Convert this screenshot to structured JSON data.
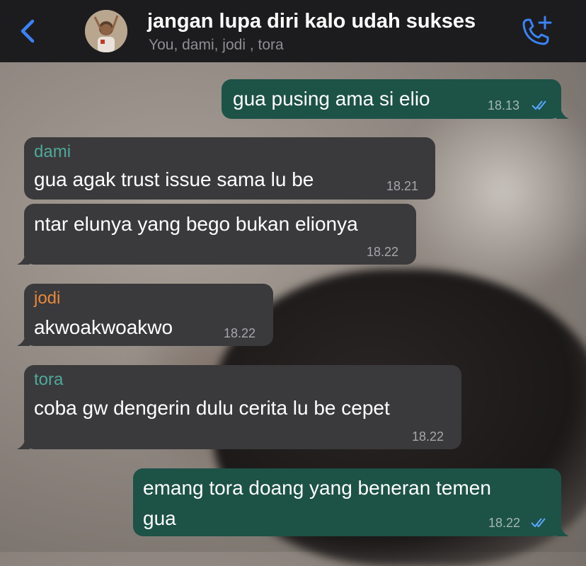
{
  "header": {
    "back_icon": "chevron-left-icon",
    "title": "jangan lupa diri kalo udah sukses",
    "subtitle": "You, dami, jodi , tora",
    "call_icon": "add-call-icon",
    "accent_color": "#3b82f6"
  },
  "messages": [
    {
      "direction": "outgoing",
      "text": "gua pusing ama si elio",
      "time": "18.13",
      "read": true
    },
    {
      "direction": "incoming",
      "sender": "dami",
      "sender_color": "#4fa89a",
      "text": "gua agak trust issue sama lu be",
      "time": "18.21"
    },
    {
      "direction": "incoming",
      "text": "ntar elunya yang bego bukan elionya",
      "time": "18.22"
    },
    {
      "direction": "incoming",
      "sender": "jodi",
      "sender_color": "#e8883a",
      "text": "akwoakwoakwo",
      "time": "18.22"
    },
    {
      "direction": "incoming",
      "sender": "tora",
      "sender_color": "#4fa89a",
      "text": "coba gw dengerin dulu cerita lu be cepet",
      "time": "18.22"
    },
    {
      "direction": "outgoing",
      "text_line1": "emang tora doang yang beneran temen",
      "text_line2": "gua",
      "time": "18.22",
      "read": true
    }
  ]
}
